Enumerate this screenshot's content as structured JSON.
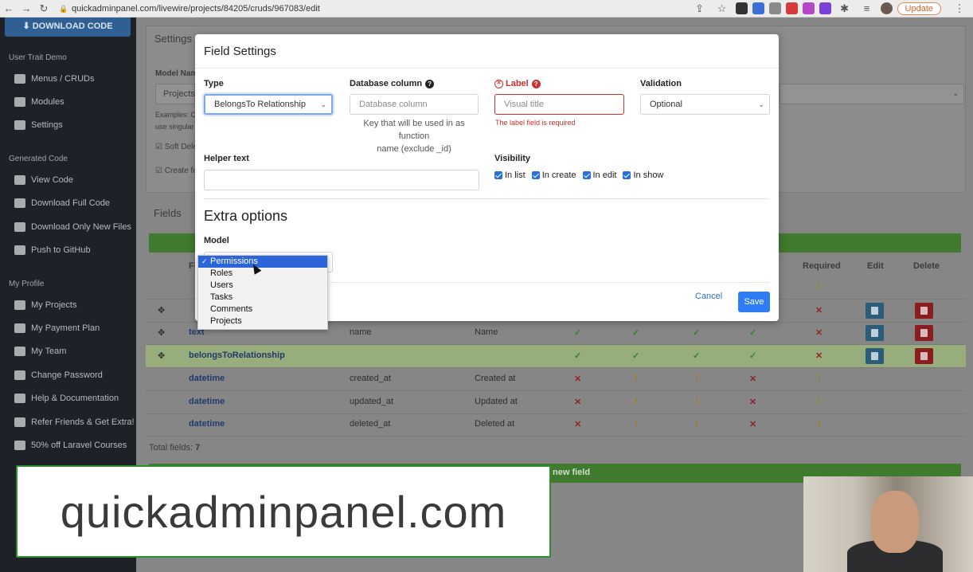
{
  "browser": {
    "url": "quickadminpanel.com/livewire/projects/84205/cruds/967083/edit",
    "update_label": "Update"
  },
  "sidebar": {
    "download_code": "DOWNLOAD CODE",
    "section_user": "User Trait Demo",
    "items_top": [
      "Menus / CRUDs",
      "Modules",
      "Settings"
    ],
    "section_generated": "Generated Code",
    "items_generated": [
      "View Code",
      "Download Full Code",
      "Download Only New Files",
      "Push to GitHub"
    ],
    "section_profile": "My Profile",
    "items_profile": [
      "My Projects",
      "My Payment Plan",
      "My Team",
      "Change Password",
      "Help & Documentation",
      "Refer Friends & Get Extra!",
      "50% off Laravel Courses"
    ]
  },
  "background": {
    "settings_title": "Settings",
    "model_name_label": "Model Nam",
    "model_name_value": "Projects",
    "examples_text": "Examples: Co",
    "use_singular_text": "use singular",
    "soft_delete_label": "Soft Dele",
    "create_label": "Create fo",
    "fields_title": "Fields",
    "col_field": "Fi",
    "col_required": "Required",
    "col_edit": "Edit",
    "col_delete": "Delete",
    "rows": [
      {
        "type": "text",
        "name": "name",
        "label": "Name"
      },
      {
        "type": "belongsToRelationship",
        "name": "",
        "label": ""
      },
      {
        "type": "datetime",
        "name": "created_at",
        "label": "Created at"
      },
      {
        "type": "datetime",
        "name": "updated_at",
        "label": "Updated at"
      },
      {
        "type": "datetime",
        "name": "deleted_at",
        "label": "Deleted at"
      }
    ],
    "total_fields_label": "Total fields:",
    "total_fields_value": "7",
    "add_field_label": "new field"
  },
  "modal": {
    "title": "Field Settings",
    "type_label": "Type",
    "type_value": "BelongsTo Relationship",
    "db_column_label": "Database column",
    "db_column_placeholder": "Database column",
    "db_column_hint_line1": "Key that will be used in as function",
    "db_column_hint_line2": "name (exclude _id)",
    "label_label": "Label",
    "label_placeholder": "Visual title",
    "label_error": "The label field is required",
    "validation_label": "Validation",
    "validation_value": "Optional",
    "helper_label": "Helper text",
    "visibility_label": "Visibility",
    "visibility_options": [
      "In list",
      "In create",
      "In edit",
      "In show"
    ],
    "extra_title": "Extra options",
    "model_label": "Model",
    "cancel_label": "Cancel",
    "save_label": "Save"
  },
  "dropdown": {
    "options": [
      "Permissions",
      "Roles",
      "Users",
      "Tasks",
      "Comments",
      "Projects"
    ],
    "selected": "Permissions"
  },
  "banner": {
    "text": "quickadminpanel.com"
  },
  "colors": {
    "primary": "#2f7df4",
    "error": "#c9302c",
    "sidebar_bg": "#1e2127",
    "success_bar": "#3f7a2f"
  }
}
